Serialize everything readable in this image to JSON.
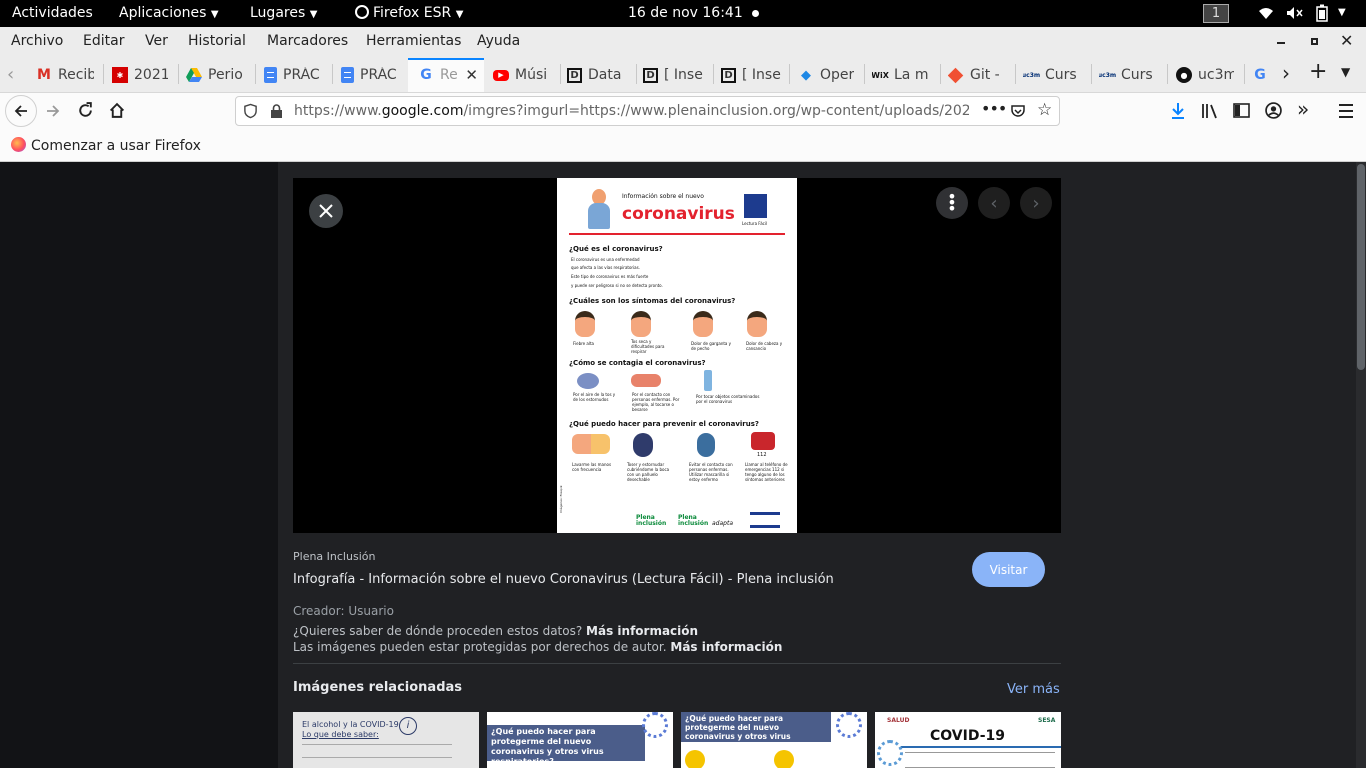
{
  "system_bar": {
    "activities": "Actividades",
    "applications": "Aplicaciones",
    "places": "Lugares",
    "app_name": "Firefox ESR",
    "datetime": "16 de nov  16:41",
    "workspace": "1"
  },
  "menu": [
    "Archivo",
    "Editar",
    "Ver",
    "Historial",
    "Marcadores",
    "Herramientas",
    "Ayuda"
  ],
  "tabs": [
    {
      "label": "Recib",
      "icon": "gmail-icon"
    },
    {
      "label": "2021",
      "icon": "madrid-icon"
    },
    {
      "label": "Perio",
      "icon": "drive-icon"
    },
    {
      "label": "PRÁC",
      "icon": "docs-icon"
    },
    {
      "label": "PRÁC",
      "icon": "docs-icon"
    },
    {
      "label": "Re",
      "icon": "google-icon"
    },
    {
      "label": "Músi",
      "icon": "youtube-icon"
    },
    {
      "label": "Data",
      "icon": "d-icon"
    },
    {
      "label": "[ Inse",
      "icon": "d-icon"
    },
    {
      "label": "[ Inse",
      "icon": "d-icon"
    },
    {
      "label": "Oper",
      "icon": "diamond-icon"
    },
    {
      "label": "La m",
      "icon": "wix-icon"
    },
    {
      "label": "Git -",
      "icon": "git-icon"
    },
    {
      "label": "Curs",
      "icon": "uc3m-icon"
    },
    {
      "label": "Curs",
      "icon": "uc3m-icon"
    },
    {
      "label": "uc3m",
      "icon": "github-icon"
    }
  ],
  "url": {
    "prefix": "https://www.",
    "domain": "google.com",
    "rest": "/imgres?imgurl=https://www.plenainclusion.org/wp-content/uploads/202"
  },
  "bookmarks": {
    "first": "Comenzar a usar Firefox"
  },
  "result": {
    "source": "Plena Inclusión",
    "title": "Infografía - Información sobre el nuevo Coronavirus (Lectura Fácil) - Plena inclusión",
    "visit_label": "Visitar",
    "creator": "Creador: Usuario",
    "question": "¿Quieres saber de dónde proceden estos datos?",
    "more_info": "Más información",
    "copyright": "Las imágenes pueden estar protegidas por derechos de autor.",
    "more_info2": "Más información"
  },
  "related": {
    "heading": "Imágenes relacionadas",
    "see_more": "Ver más"
  },
  "infographic": {
    "header_small": "Información sobre el  nuevo",
    "header_big": "coronavirus",
    "logo_label": "Lectura Fácil",
    "q1": "¿Qué es el coronavirus?",
    "a1": [
      "El coronavirus es una enfermedad",
      "que afecta a las vías respiratorias.",
      "Este tipo de coronavirus es más fuerte",
      "y puede ser peligroso si no se detecta pronto."
    ],
    "q2": "¿Cuáles son los síntomas del coronavirus?",
    "symptoms": [
      "Fiebre alta",
      "Tos seca y dificultades para respirar",
      "Dolor de garganta y de pecho",
      "Dolor de cabeza y cansancio"
    ],
    "q3": "¿Cómo se contagia el coronavirus?",
    "contagion": [
      "Por el aire de la tos y de los estornudos",
      "Por el contacto con personas enfermas. Por ejemplo, al tocarse o besarse",
      "Por tocar objetos contaminados por el coronavirus"
    ],
    "q4": "¿Qué puedo hacer para prevenir el coronavirus?",
    "prevention": [
      "Lavarme las manos con frecuencia",
      "Toser y estornudar cubriéndome la boca con un pañuelo desechable",
      "Evitar el contacto con personas enfermas. Utilizar mascarilla si estoy enfermo",
      "Llamar al teléfono de emergencias 112 si tengo alguno de los síntomas anteriores"
    ],
    "phone": "112",
    "footer_a": "Plena inclusión",
    "footer_b": "Plena inclusión",
    "footer_c": "adapta",
    "credit": "Imágenes: Freepik"
  },
  "related_cards": [
    {
      "title": "El alcohol y la COVID-19",
      "sub": "Lo que debe saber:"
    },
    {
      "title": "¿Qué puedo hacer para protegerme del nuevo coronavirus y otros virus respiratorios?"
    },
    {
      "title": "¿Qué puedo hacer para protegerme del nuevo coronavirus y otros virus respiratorios?"
    },
    {
      "title": "COVID-19",
      "brand": "SALUD",
      "brand2": "SESA"
    }
  ]
}
